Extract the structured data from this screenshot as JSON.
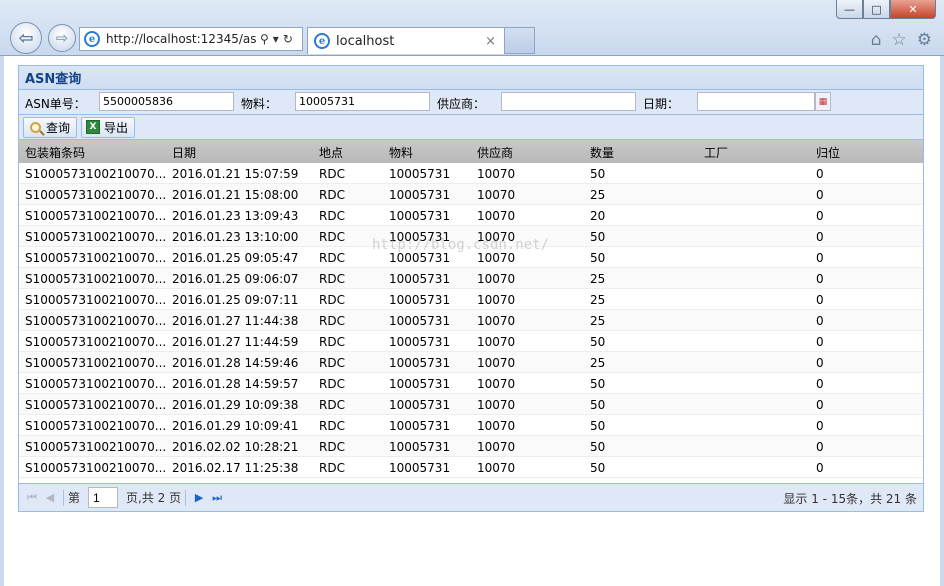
{
  "browser": {
    "url": "http://localhost:12345/as",
    "tab_title": "localhost",
    "search_glyph": "⚲",
    "dropdown_glyph": "▾",
    "refresh_glyph": "↻",
    "close_tab_glyph": "×",
    "win_min": "—",
    "win_max": "□",
    "win_close": "✕",
    "tool_icons": [
      "home-icon",
      "star-icon",
      "gear-icon"
    ]
  },
  "panel": {
    "title": "ASN查询"
  },
  "filter": {
    "asn_label": "ASN单号：",
    "asn_value": "5500005836",
    "material_label": "物料：",
    "material_value": "10005731",
    "supplier_label": "供应商：",
    "supplier_value": "",
    "date_label": "日期：",
    "date_value": ""
  },
  "toolbar": {
    "query_label": "查询",
    "export_label": "导出"
  },
  "grid": {
    "columns": [
      "包装箱条码",
      "日期",
      "地点",
      "物料",
      "供应商",
      "数量",
      "工厂",
      "归位"
    ],
    "rows": [
      [
        "S1000573100210070...",
        "2016.01.21 15:07:59",
        "RDC",
        "10005731",
        "10070",
        "50",
        "",
        "0"
      ],
      [
        "S1000573100210070...",
        "2016.01.21 15:08:00",
        "RDC",
        "10005731",
        "10070",
        "25",
        "",
        "0"
      ],
      [
        "S1000573100210070...",
        "2016.01.23 13:09:43",
        "RDC",
        "10005731",
        "10070",
        "20",
        "",
        "0"
      ],
      [
        "S1000573100210070...",
        "2016.01.23 13:10:00",
        "RDC",
        "10005731",
        "10070",
        "50",
        "",
        "0"
      ],
      [
        "S1000573100210070...",
        "2016.01.25 09:05:47",
        "RDC",
        "10005731",
        "10070",
        "50",
        "",
        "0"
      ],
      [
        "S1000573100210070...",
        "2016.01.25 09:06:07",
        "RDC",
        "10005731",
        "10070",
        "25",
        "",
        "0"
      ],
      [
        "S1000573100210070...",
        "2016.01.25 09:07:11",
        "RDC",
        "10005731",
        "10070",
        "25",
        "",
        "0"
      ],
      [
        "S1000573100210070...",
        "2016.01.27 11:44:38",
        "RDC",
        "10005731",
        "10070",
        "25",
        "",
        "0"
      ],
      [
        "S1000573100210070...",
        "2016.01.27 11:44:59",
        "RDC",
        "10005731",
        "10070",
        "50",
        "",
        "0"
      ],
      [
        "S1000573100210070...",
        "2016.01.28 14:59:46",
        "RDC",
        "10005731",
        "10070",
        "25",
        "",
        "0"
      ],
      [
        "S1000573100210070...",
        "2016.01.28 14:59:57",
        "RDC",
        "10005731",
        "10070",
        "50",
        "",
        "0"
      ],
      [
        "S1000573100210070...",
        "2016.01.29 10:09:38",
        "RDC",
        "10005731",
        "10070",
        "50",
        "",
        "0"
      ],
      [
        "S1000573100210070...",
        "2016.01.29 10:09:41",
        "RDC",
        "10005731",
        "10070",
        "50",
        "",
        "0"
      ],
      [
        "S1000573100210070...",
        "2016.02.02 10:28:21",
        "RDC",
        "10005731",
        "10070",
        "50",
        "",
        "0"
      ],
      [
        "S1000573100210070...",
        "2016.02.17 11:25:38",
        "RDC",
        "10005731",
        "10070",
        "50",
        "",
        "0"
      ]
    ]
  },
  "pager": {
    "page_prefix": "第",
    "page_value": "1",
    "page_suffix": "页,共 2 页",
    "info": "显示 1 - 15条，共 21 条"
  },
  "watermark": "http://blog.csdn.net/",
  "colors": {
    "panel_border": "#99bbe8",
    "header_text": "#15428b",
    "toolbar_bg": "#dfe8f6",
    "grid_header_bg": "#c0c0c0"
  }
}
